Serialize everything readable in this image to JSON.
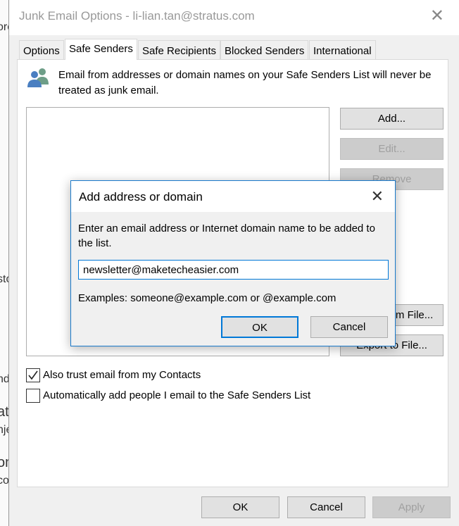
{
  "background_fragments": [
    "ore",
    "sto",
    "nd",
    "at",
    "nje",
    "om",
    "co"
  ],
  "window": {
    "title": "Junk Email Options - li-lian.tan@stratus.com"
  },
  "tabs": [
    {
      "label": "Options"
    },
    {
      "label": "Safe Senders"
    },
    {
      "label": "Safe Recipients"
    },
    {
      "label": "Blocked Senders"
    },
    {
      "label": "International"
    }
  ],
  "safe_senders": {
    "description": "Email from addresses or domain names on your Safe Senders List will never be treated as junk email.",
    "buttons": {
      "add": "Add...",
      "edit": "Edit...",
      "remove": "Remove",
      "import": "Import from File...",
      "export": "Export to File..."
    },
    "checkboxes": [
      {
        "label": "Also trust email from my Contacts",
        "checked": true
      },
      {
        "label": "Automatically add people I email to the Safe Senders List",
        "checked": false
      }
    ]
  },
  "footer": {
    "ok": "OK",
    "cancel": "Cancel",
    "apply": "Apply"
  },
  "modal": {
    "title": "Add address or domain",
    "prompt": "Enter an email address or Internet domain name to be added to the list.",
    "input_value": "newsletter@maketecheasier.com",
    "examples": "Examples: someone@example.com or @example.com",
    "ok": "OK",
    "cancel": "Cancel"
  },
  "colors": {
    "accent": "#0078d7",
    "icon_blue": "#4a7fc1",
    "icon_green": "#6e9e88"
  }
}
